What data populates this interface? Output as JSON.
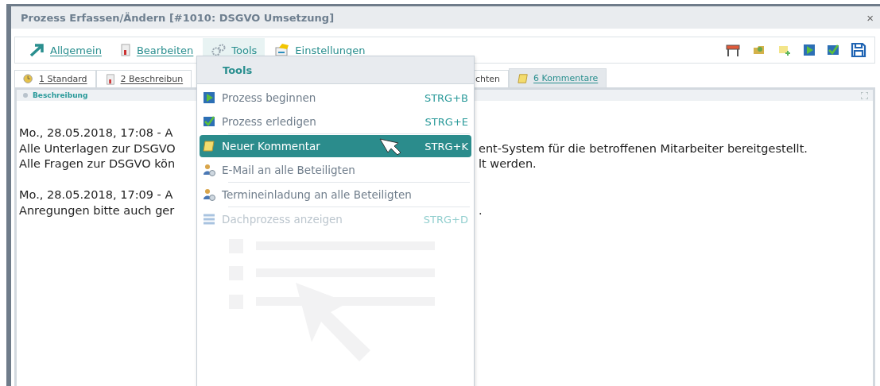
{
  "window": {
    "title": "Prozess Erfassen/Ändern [#1010: DSGVO Umsetzung]",
    "close": "×"
  },
  "menubar": [
    {
      "label": "Allgemein",
      "selected": false
    },
    {
      "label": "Bearbeiten",
      "selected": false
    },
    {
      "label": "Tools",
      "selected": true
    },
    {
      "label": "Einstellungen",
      "selected": false
    }
  ],
  "tabs": [
    {
      "label": "1 Standard",
      "selected": false
    },
    {
      "label": "2 Beschreibun",
      "selected": false
    },
    {
      "label": "chten",
      "selected": false
    },
    {
      "label": "6 Kommentare",
      "selected": true
    }
  ],
  "panel": {
    "title": "Beschreibung",
    "comments": [
      {
        "lines": [
          {
            "left": "Mo., 28.05.2018, 17:08 - A"
          },
          {
            "left": "Alle Unterlagen zur DSGVO",
            "right": "ent-System für die betroffenen Mitarbeiter bereitgestellt."
          },
          {
            "left": "Alle Fragen zur DSGVO kön",
            "right": "lt werden."
          }
        ]
      },
      {
        "lines": [
          {
            "left": "Mo., 28.05.2018, 17:09 - A"
          },
          {
            "left": "Anregungen bitte auch ger",
            "right": "."
          }
        ]
      }
    ]
  },
  "menu": {
    "title": "Tools",
    "items": [
      {
        "label": "Prozess beginnen",
        "shortcut": "STRG+B",
        "selected": false,
        "disabled": false,
        "divider": false
      },
      {
        "label": "Prozess erledigen",
        "shortcut": "STRG+E",
        "selected": false,
        "disabled": false,
        "divider": false
      },
      {
        "label": "Neuer Kommentar",
        "shortcut": "STRG+K",
        "selected": true,
        "disabled": false,
        "divider": true
      },
      {
        "label": "E-Mail an alle Beteiligten",
        "selected": false,
        "disabled": false,
        "divider": false
      },
      {
        "label": "Termineinladung an alle Beteiligten",
        "selected": false,
        "disabled": false,
        "divider": true
      },
      {
        "label": "Dachprozess anzeigen",
        "shortcut": "STRG+D",
        "selected": false,
        "disabled": true,
        "divider": true
      }
    ]
  }
}
